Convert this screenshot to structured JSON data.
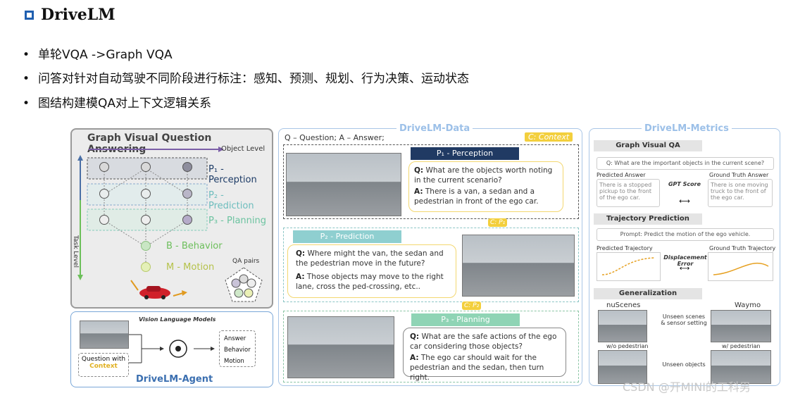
{
  "title": "DriveLM",
  "bullets": [
    "单轮VQA ->Graph VQA",
    "问答对针对自动驾驶不同阶段进行标注：感知、预测、规划、行为决策、运动状态",
    "图结构建模QA对上下文逻辑关系"
  ],
  "graph": {
    "title": "Graph Visual Question Answering",
    "object_level": "Object Level",
    "task_level": "Task Level",
    "levels": [
      "P₁ - Perception",
      "P₂ - Prediction",
      "P₃ - Planning",
      "B - Behavior",
      "M - Motion"
    ],
    "qa_pairs": "QA pairs"
  },
  "agent": {
    "vlm": "Vision Language Models",
    "question_with": "Question with",
    "context": "Context",
    "outputs": [
      "Answer",
      "Behavior",
      "Motion"
    ],
    "title": "DriveLM-Agent"
  },
  "data": {
    "title": "DriveLM-Data",
    "legend": "Q – Question; A – Answer;",
    "context_tag": "C: Context",
    "c1": "C: P₁",
    "c2": "C: P₂",
    "perception": {
      "bar": "P₁ - Perception",
      "q_pre": "Q:",
      "q": "What are the objects worth noting in the current scenario?",
      "a_pre": "A:",
      "a": "There is a van, a sedan and a pedestrian in front of the ego car."
    },
    "prediction": {
      "bar": "P₂ - Prediction",
      "q_pre": "Q:",
      "q": "Where might the van, the sedan and the pedestrian move in the future?",
      "a_pre": "A:",
      "a": "Those objects may move to the right lane, cross the ped-crossing, etc.."
    },
    "planning": {
      "bar": "P₃ - Planning",
      "q_pre": "Q:",
      "q": "What are the safe actions of the ego car considering those objects?",
      "a_pre": "A:",
      "a": "The ego car should wait for the pedestrian and the sedan, then turn right."
    }
  },
  "metrics": {
    "title": "DriveLM-Metrics",
    "gvqa": "Graph Visual QA",
    "gvqa_q": "Q: What are the important objects in the current scene?",
    "pred_answer": "Predicted Answer",
    "gt_answer": "Ground Truth Answer",
    "pred_text": "There is a stopped pickup to the front of the ego car.",
    "gt_text": "There is one moving truck to the front of the ego car.",
    "gpt_score": "GPT Score",
    "traj": "Trajectory Prediction",
    "prompt": "Prompt: Predict the motion of the ego vehicle.",
    "pred_traj": "Predicted Trajectory",
    "gt_traj": "Ground Truth Trajectory",
    "disp_error": "Displacement Error",
    "gen": "Generalization",
    "nuscenes": "nuScenes",
    "waymo": "Waymo",
    "unseen_scenes": "Unseen scenes & sensor setting",
    "wo_ped": "w/o pedestrian",
    "w_ped": "w/ pedestrian",
    "unseen_objects": "Unseen objects"
  },
  "watermark": "CSDN @开MINI的工科男"
}
